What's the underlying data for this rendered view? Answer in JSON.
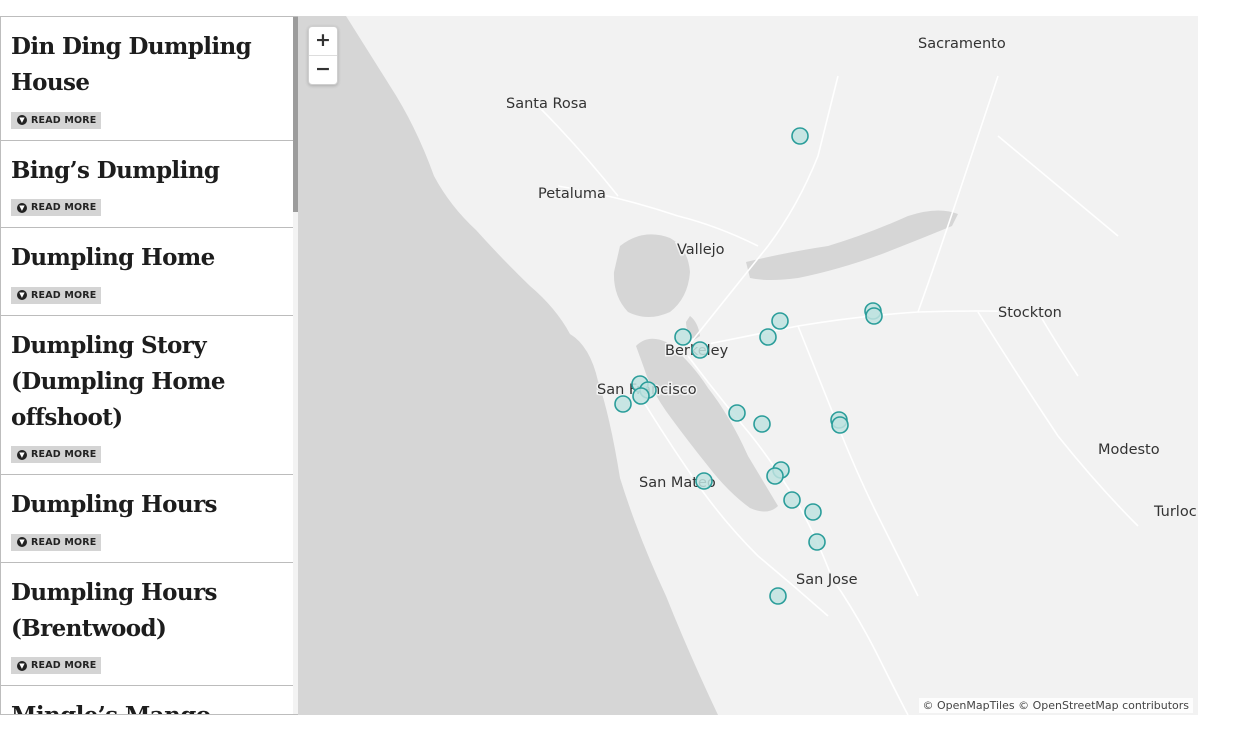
{
  "list": {
    "read_more_label": "READ MORE",
    "items": [
      {
        "title": "Din Ding Dumpling House"
      },
      {
        "title": "Bing’s Dumpling"
      },
      {
        "title": "Dumpling Home"
      },
      {
        "title": "Dumpling Story (Dumpling Home offshoot)"
      },
      {
        "title": "Dumpling Hours"
      },
      {
        "title": "Dumpling Hours (Brentwood)"
      },
      {
        "title": "Mingle’s Mango"
      }
    ]
  },
  "map": {
    "zoom_in": "+",
    "zoom_out": "−",
    "attribution": "© OpenMapTiles © OpenStreetMap contributors",
    "cities": [
      "Sacramento",
      "Santa Rosa",
      "Petaluma",
      "Vallejo",
      "Stockton",
      "Berkeley",
      "San Francisco",
      "Modesto",
      "San Mateo",
      "Turloc",
      "San Jose"
    ],
    "marker_color": "#2a9d9a",
    "marker_fill": "#bfe3e0",
    "water_color": "#d6d6d6",
    "land_color": "#f2f2f2"
  }
}
